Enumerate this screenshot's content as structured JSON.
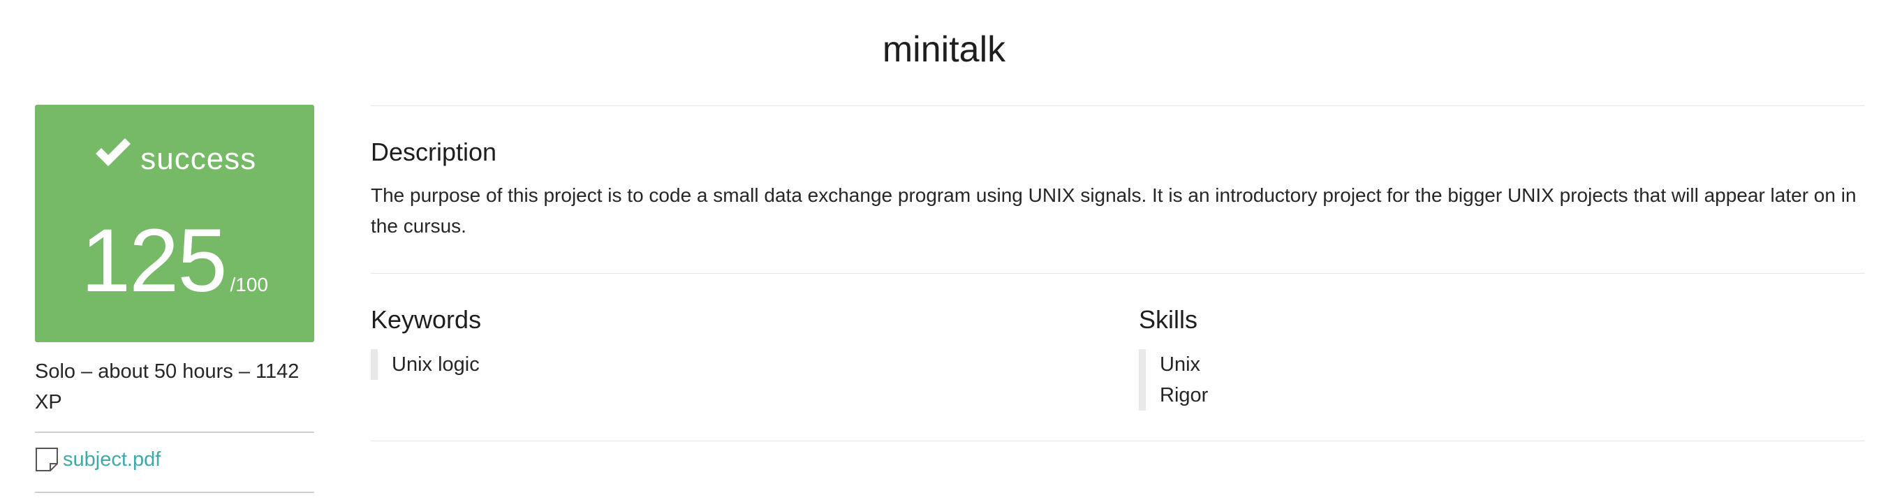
{
  "project": {
    "title": "minitalk"
  },
  "result": {
    "status": "success",
    "score": "125",
    "score_max": "/100",
    "color": "#76b966"
  },
  "meta": {
    "info": "Solo – about 50 hours – 1142 XP"
  },
  "attachment": {
    "icon": "document-icon",
    "label": "subject.pdf",
    "link_color": "#3eaaa8"
  },
  "description": {
    "heading": "Description",
    "text": "The purpose of this project is to code a small data exchange program using UNIX signals. It is an introductory project for the bigger UNIX projects that will appear later on in the cursus."
  },
  "keywords": {
    "heading": "Keywords",
    "items": [
      "Unix logic"
    ]
  },
  "skills": {
    "heading": "Skills",
    "items": [
      "Unix",
      "Rigor"
    ]
  }
}
